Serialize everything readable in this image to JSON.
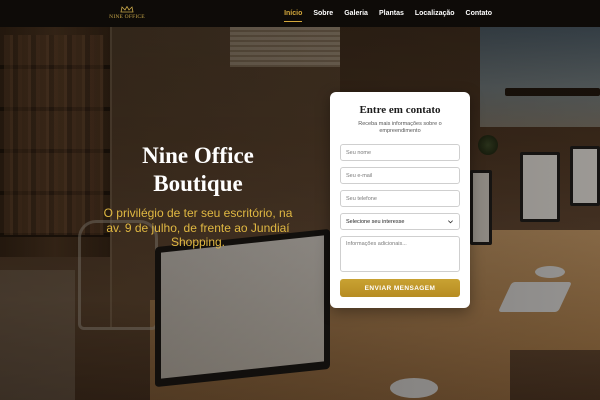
{
  "brand": {
    "logo_text": "NINE OFFICE",
    "accent_color": "#d4a83c"
  },
  "nav": {
    "items": [
      {
        "label": "Início",
        "active": true
      },
      {
        "label": "Sobre",
        "active": false
      },
      {
        "label": "Galeria",
        "active": false
      },
      {
        "label": "Plantas",
        "active": false
      },
      {
        "label": "Localização",
        "active": false
      },
      {
        "label": "Contato",
        "active": false
      }
    ]
  },
  "hero": {
    "title_line1": "Nine Office",
    "title_line2": "Boutique",
    "subtitle": "O privilégio de ter seu escritório, na av. 9 de julho, de frente ao Jundiaí Shopping."
  },
  "form": {
    "title": "Entre em contato",
    "subtitle": "Receba mais informações sobre o empreendimento",
    "name_placeholder": "Seu nome",
    "email_placeholder": "Seu e-mail",
    "phone_placeholder": "Seu telefone",
    "interest_selected": "Selecione seu interesse",
    "message_placeholder": "Informações adicionais...",
    "submit_label": "ENVIAR MENSAGEM",
    "submit_color": "#c09a2c"
  },
  "icons": {
    "logo": "crown-logo-icon",
    "select": "chevron-down-icon"
  }
}
